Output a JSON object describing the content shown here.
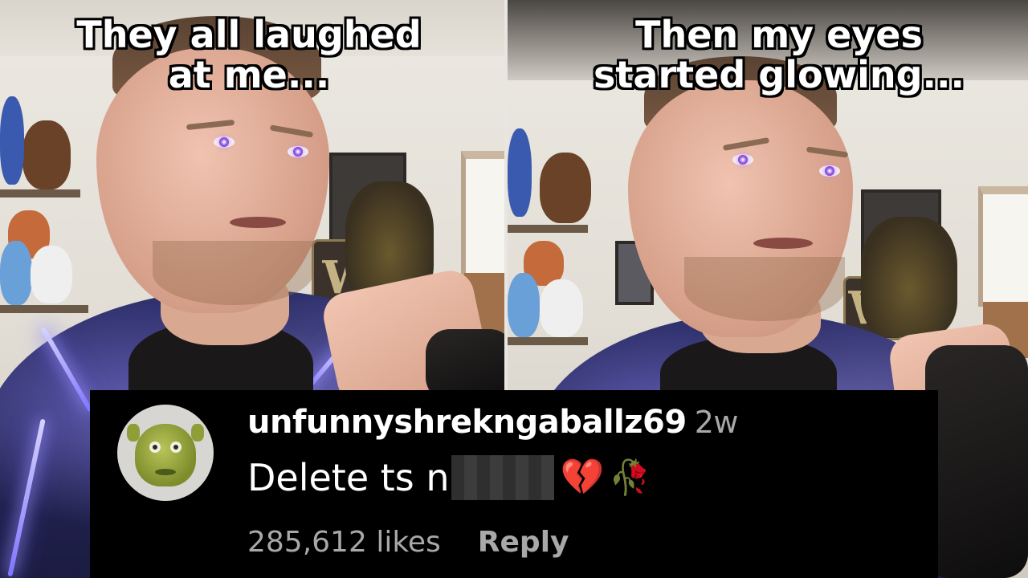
{
  "captions": {
    "left": "They all laughed at me...",
    "right": "Then my eyes started glowing..."
  },
  "comment": {
    "username": "unfunnyshrekngaballz69",
    "age": "2w",
    "text_visible": "Delete ts n",
    "censored": true,
    "emojis": [
      {
        "name": "broken-heart-emoji",
        "glyph": "💔"
      },
      {
        "name": "wilted-rose-emoji",
        "glyph": "🥀"
      }
    ],
    "likes": "285,612 likes",
    "reply_label": "Reply",
    "avatar_icon": "shrek-avatar"
  },
  "colors": {
    "comment_bg": "#000000",
    "secondary_text": "#a8a8a8",
    "eye_glow": "#9b5cf0"
  }
}
